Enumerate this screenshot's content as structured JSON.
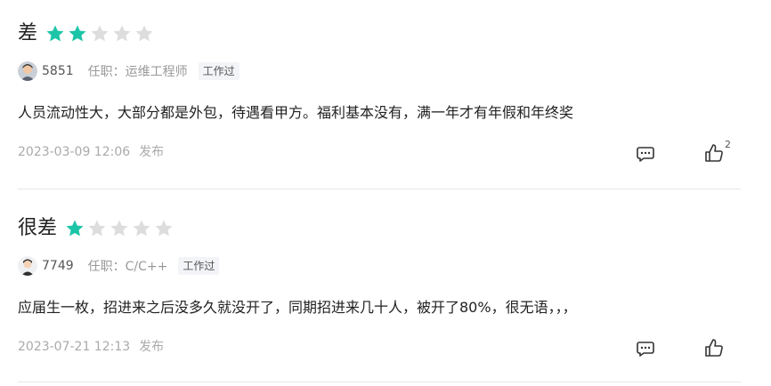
{
  "colors": {
    "star_on": "#1cc5a7",
    "star_off": "#dddddd",
    "divider": "#e6e6e6"
  },
  "reviews": [
    {
      "rating_label": "差",
      "stars": 2,
      "max_stars": 5,
      "user_id": "5851",
      "job": "任职：运维工程师",
      "tag": "工作过",
      "content": "人员流动性大，大部分都是外包，待遇看甲方。福利基本没有，满一年才有年假和年终奖",
      "time": "2023-03-09 12:06",
      "action": "发布",
      "like_count": "2"
    },
    {
      "rating_label": "很差",
      "stars": 1,
      "max_stars": 5,
      "user_id": "7749",
      "job": "任职：C/C++",
      "tag": "工作过",
      "content": "应届生一枚，招进来之后没多久就没开了，同期招进来几十人，被开了80%，很无语，，，",
      "time": "2023-07-21 12:13",
      "action": "发布",
      "like_count": ""
    }
  ]
}
